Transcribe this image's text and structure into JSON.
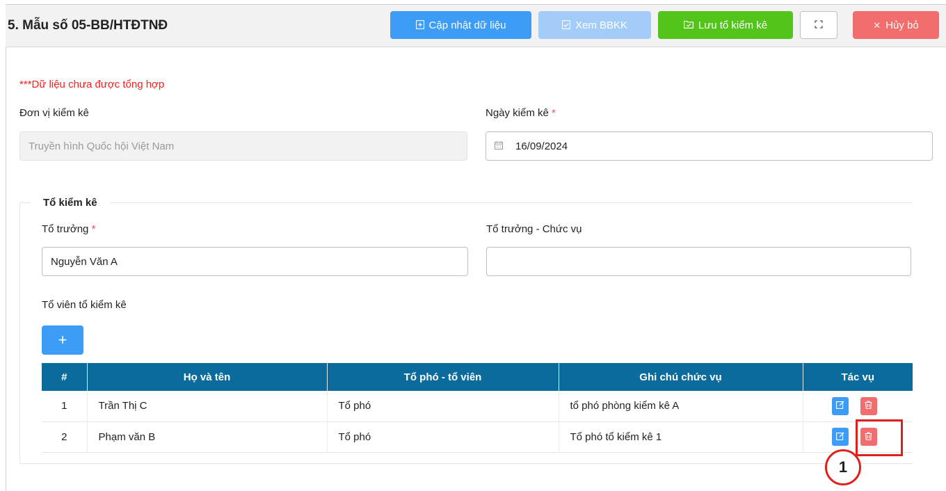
{
  "header": {
    "title": "5. Mẫu số 05-BB/HTĐTNĐ",
    "buttons": {
      "update": "Cập nhật dữ liệu",
      "view": "Xem BBKK",
      "save": "Lưu tổ kiểm kê",
      "cancel": "Hủy bỏ"
    }
  },
  "warning": "***Dữ liệu chưa được tổng hợp",
  "form": {
    "unit_label": "Đơn vị kiểm kê",
    "unit_value": "Truyền hình Quốc hội Việt Nam",
    "date_label": "Ngày kiểm kê",
    "date_value": "16/09/2024",
    "required_mark": "*"
  },
  "team": {
    "legend": "Tổ kiểm kê",
    "leader_label": "Tổ trưởng",
    "leader_value": "Nguyễn Văn A",
    "leader_position_label": "Tổ trưởng - Chức vụ",
    "leader_position_value": "",
    "members_label": "Tổ viên tổ kiểm kê",
    "add_label": "+"
  },
  "table": {
    "headers": [
      "#",
      "Họ và tên",
      "Tổ phó - tổ viên",
      "Ghi chú chức vụ",
      "Tác vụ"
    ],
    "rows": [
      {
        "no": "1",
        "name": "Trần Thị C",
        "role": "Tổ phó",
        "note": "tổ phó phòng kiểm kê A"
      },
      {
        "no": "2",
        "name": "Phạm văn B",
        "role": "Tổ phó",
        "note": "Tổ phó tổ kiểm kê 1"
      }
    ]
  },
  "annotation": {
    "callout_number": "1"
  },
  "colors": {
    "primary": "#3d9cf5",
    "success": "#52c41a",
    "danger": "#f26d6d",
    "table_header": "#0a6b9c",
    "warning_text": "#ff1a1a",
    "annotation": "#e0201c"
  }
}
